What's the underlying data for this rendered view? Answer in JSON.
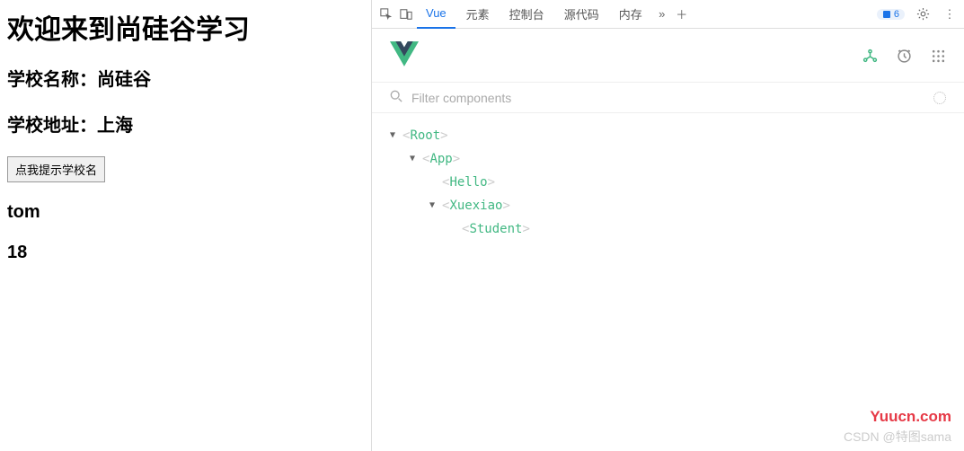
{
  "page": {
    "title": "欢迎来到尚硅谷学习",
    "school_name": "学校名称：尚硅谷",
    "school_addr": "学校地址：上海",
    "button_label": "点我提示学校名",
    "student_name": "tom",
    "student_age": "18"
  },
  "devtools": {
    "tabs": {
      "vue": "Vue",
      "elements": "元素",
      "console": "控制台",
      "sources": "源代码",
      "memory": "内存"
    },
    "badge_count": "6"
  },
  "filter": {
    "placeholder": "Filter components"
  },
  "tree": {
    "root": "Root",
    "app": "App",
    "hello": "Hello",
    "xuexiao": "Xuexiao",
    "student": "Student"
  },
  "watermarks": {
    "site": "Yuucn.com",
    "csdn": "CSDN @特图sama"
  }
}
